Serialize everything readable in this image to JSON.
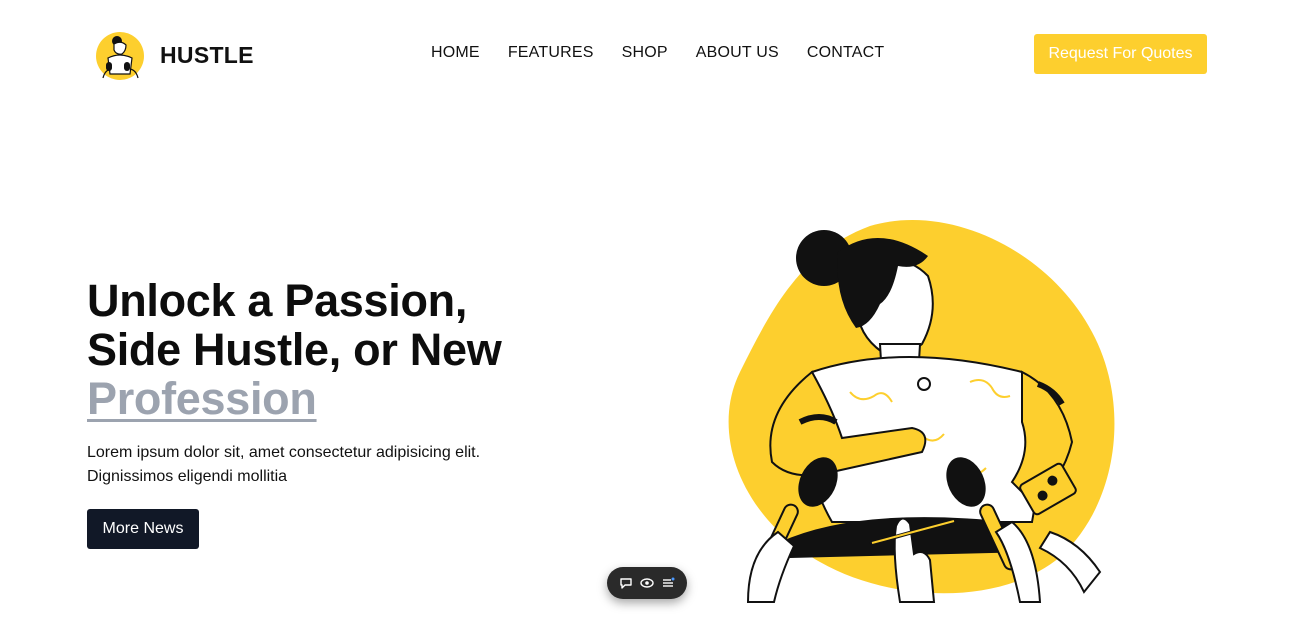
{
  "brand": {
    "name": "HUSTLE",
    "logo_icon": "woman-illustration-logo"
  },
  "nav": {
    "items": [
      {
        "label": "HOME"
      },
      {
        "label": "FEATURES"
      },
      {
        "label": "SHOP"
      },
      {
        "label": "ABOUT US"
      },
      {
        "label": "CONTACT"
      }
    ]
  },
  "header": {
    "cta_label": "Request For Quotes"
  },
  "hero": {
    "title_line1": "Unlock a Passion,",
    "title_line2": "Side Hustle, or New",
    "title_accent": "Profession",
    "description": "Lorem ipsum dolor sit, amet consectetur adipisicing elit. Dignissimos eligendi mollitia",
    "button_label": "More News",
    "illustration": "woman-interview-microphones-illustration"
  },
  "floating_toolbar": {
    "icons": [
      "comment-icon",
      "eye-icon",
      "menu-icon"
    ]
  },
  "colors": {
    "accent_yellow": "#fdcf2e",
    "dark_button": "#111827",
    "accent_gray_text": "#9ca3af"
  }
}
